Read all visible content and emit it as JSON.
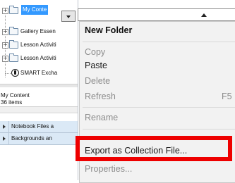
{
  "tree": {
    "items": [
      {
        "label": "My Conte",
        "expand": "+"
      },
      {
        "label": "Gallery Essen",
        "expand": "+"
      },
      {
        "label": "Lesson Activiti",
        "expand": "+"
      },
      {
        "label": "Lesson Activiti",
        "expand": "+"
      },
      {
        "label": "SMART Excha",
        "expand": ""
      }
    ]
  },
  "info": {
    "title": "My Content",
    "count": "36 items"
  },
  "collections": [
    {
      "label": "Notebook Files a"
    },
    {
      "label": "Backgrounds an"
    }
  ],
  "context_menu": {
    "items": [
      {
        "label": "New Folder",
        "state": "bold"
      },
      {
        "label": "Copy",
        "state": "disabled"
      },
      {
        "label": "Paste",
        "state": "enabled"
      },
      {
        "label": "Delete",
        "state": "disabled"
      },
      {
        "label": "Refresh",
        "state": "disabled",
        "shortcut": "F5"
      },
      {
        "label": "Rename",
        "state": "disabled"
      },
      {
        "label": "Export as Collection File...",
        "state": "enabled"
      },
      {
        "label": "Properties...",
        "state": "disabled"
      }
    ]
  },
  "highlight": {
    "target": "Export as Collection File...",
    "color": "#ee0000"
  }
}
